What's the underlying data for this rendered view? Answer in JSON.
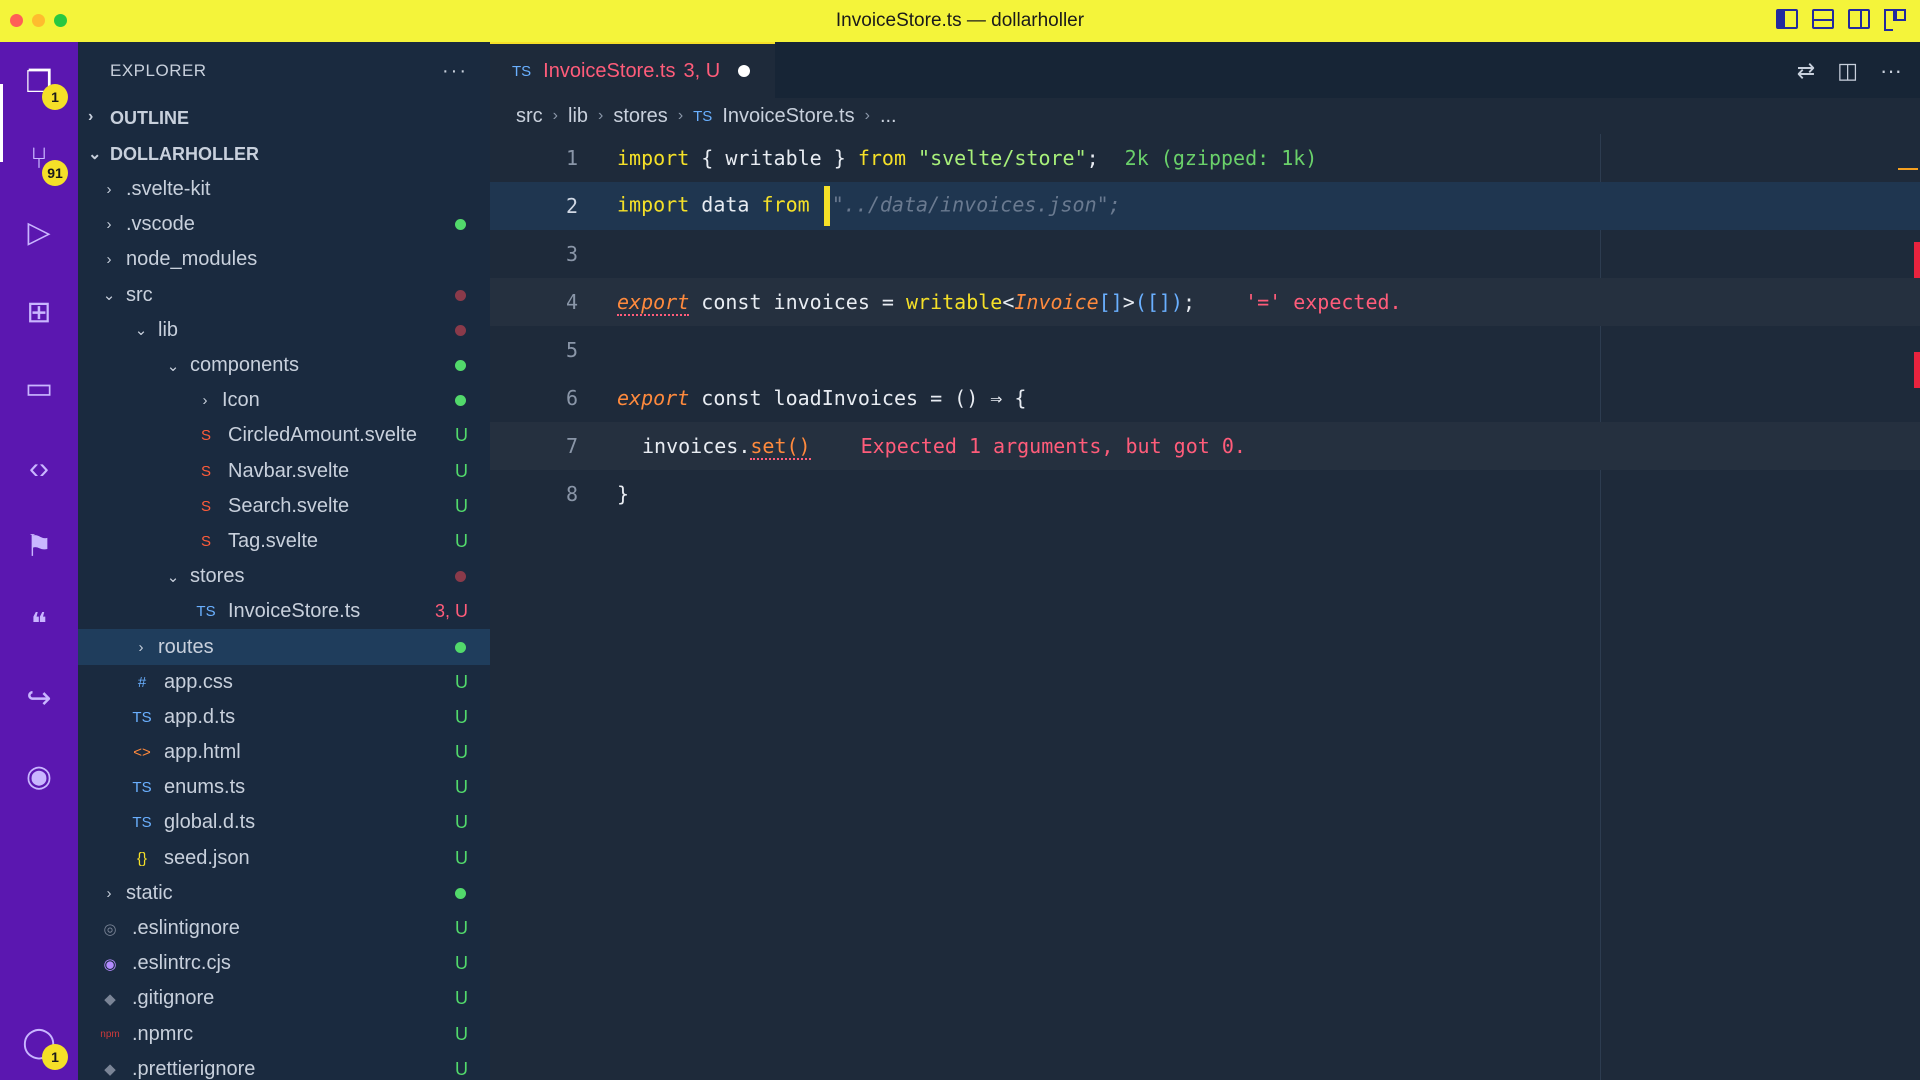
{
  "window": {
    "title": "InvoiceStore.ts — dollarholler"
  },
  "activity_bar": {
    "items": [
      {
        "name": "explorer-icon",
        "glyph": "❐",
        "badge": "1"
      },
      {
        "name": "source-control-icon",
        "glyph": "⑂",
        "badge": "91"
      },
      {
        "name": "run-debug-icon",
        "glyph": "▷",
        "badge": ""
      },
      {
        "name": "extensions-icon",
        "glyph": "⊞",
        "badge": ""
      },
      {
        "name": "folder-icon",
        "glyph": "▭",
        "badge": ""
      },
      {
        "name": "code-icon",
        "glyph": "‹›",
        "badge": ""
      },
      {
        "name": "bookmark-icon",
        "glyph": "⚑",
        "badge": ""
      },
      {
        "name": "quote-icon",
        "glyph": "❝",
        "badge": ""
      },
      {
        "name": "share-icon",
        "glyph": "↪",
        "badge": ""
      },
      {
        "name": "github-icon",
        "glyph": "◉",
        "badge": ""
      }
    ],
    "account_badge": "1"
  },
  "sidebar": {
    "header": "EXPLORER",
    "more": "···",
    "outline_label": "OUTLINE",
    "project_label": "DOLLARHOLLER",
    "tree": [
      {
        "name": ".svelte-kit",
        "depth": 0,
        "chev": "›",
        "icon": "",
        "color": "dim",
        "status": "",
        "dot": ""
      },
      {
        "name": ".vscode",
        "depth": 0,
        "chev": "›",
        "icon": "",
        "color": "green",
        "status": "",
        "dot": "#52d96b"
      },
      {
        "name": "node_modules",
        "depth": 0,
        "chev": "›",
        "icon": "",
        "color": "dim",
        "status": "",
        "dot": ""
      },
      {
        "name": "src",
        "depth": 0,
        "chev": "⌄",
        "icon": "",
        "color": "red",
        "status": "",
        "dot": "#8a3a4a"
      },
      {
        "name": "lib",
        "depth": 1,
        "chev": "⌄",
        "icon": "",
        "color": "red",
        "status": "",
        "dot": "#8a3a4a"
      },
      {
        "name": "components",
        "depth": 2,
        "chev": "⌄",
        "icon": "",
        "color": "green",
        "status": "",
        "dot": "#52d96b"
      },
      {
        "name": "Icon",
        "depth": 3,
        "chev": "›",
        "icon": "",
        "color": "green",
        "status": "",
        "dot": "#52d96b"
      },
      {
        "name": "CircledAmount.svelte",
        "depth": 3,
        "chev": "",
        "icon": "S",
        "color": "green",
        "status": "U",
        "dot": ""
      },
      {
        "name": "Navbar.svelte",
        "depth": 3,
        "chev": "",
        "icon": "S",
        "color": "green",
        "status": "U",
        "dot": ""
      },
      {
        "name": "Search.svelte",
        "depth": 3,
        "chev": "",
        "icon": "S",
        "color": "green",
        "status": "U",
        "dot": ""
      },
      {
        "name": "Tag.svelte",
        "depth": 3,
        "chev": "",
        "icon": "S",
        "color": "green",
        "status": "U",
        "dot": ""
      },
      {
        "name": "stores",
        "depth": 2,
        "chev": "⌄",
        "icon": "",
        "color": "red",
        "status": "",
        "dot": "#8a3a4a"
      },
      {
        "name": "InvoiceStore.ts",
        "depth": 3,
        "chev": "",
        "icon": "TS",
        "color": "red",
        "status": "3, U",
        "dot": ""
      },
      {
        "name": "routes",
        "depth": 1,
        "chev": "›",
        "icon": "",
        "color": "green",
        "status": "",
        "dot": "#52d96b",
        "selected": true
      },
      {
        "name": "app.css",
        "depth": 1,
        "chev": "",
        "icon": "#",
        "color": "green",
        "status": "U",
        "dot": ""
      },
      {
        "name": "app.d.ts",
        "depth": 1,
        "chev": "",
        "icon": "TS",
        "color": "green",
        "status": "U",
        "dot": ""
      },
      {
        "name": "app.html",
        "depth": 1,
        "chev": "",
        "icon": "<>",
        "color": "green",
        "status": "U",
        "dot": ""
      },
      {
        "name": "enums.ts",
        "depth": 1,
        "chev": "",
        "icon": "TS",
        "color": "green",
        "status": "U",
        "dot": ""
      },
      {
        "name": "global.d.ts",
        "depth": 1,
        "chev": "",
        "icon": "TS",
        "color": "green",
        "status": "U",
        "dot": ""
      },
      {
        "name": "seed.json",
        "depth": 1,
        "chev": "",
        "icon": "{}",
        "color": "green",
        "status": "U",
        "dot": ""
      },
      {
        "name": "static",
        "depth": 0,
        "chev": "›",
        "icon": "",
        "color": "green",
        "status": "",
        "dot": "#52d96b"
      },
      {
        "name": ".eslintignore",
        "depth": 0,
        "chev": "",
        "icon": "◎",
        "color": "green",
        "status": "U",
        "dot": ""
      },
      {
        "name": ".eslintrc.cjs",
        "depth": 0,
        "chev": "",
        "icon": "◉",
        "color": "green",
        "status": "U",
        "dot": ""
      },
      {
        "name": ".gitignore",
        "depth": 0,
        "chev": "",
        "icon": "◆",
        "color": "green",
        "status": "U",
        "dot": ""
      },
      {
        "name": ".npmrc",
        "depth": 0,
        "chev": "",
        "icon": "npm",
        "color": "green",
        "status": "U",
        "dot": ""
      },
      {
        "name": ".prettierignore",
        "depth": 0,
        "chev": "",
        "icon": "◆",
        "color": "green",
        "status": "U",
        "dot": ""
      }
    ]
  },
  "editor": {
    "tab": {
      "lang": "TS",
      "name": "InvoiceStore.ts",
      "status": "3, U"
    },
    "breadcrumb": {
      "parts": [
        "src",
        "lib",
        "stores"
      ],
      "file_lang": "TS",
      "file": "InvoiceStore.ts",
      "tail": "..."
    },
    "lines": {
      "l1": {
        "num": "1",
        "kw1": "import",
        "p1": " { writable } ",
        "kw2": "from",
        "p2": " ",
        "str": "\"svelte/store\"",
        "p3": ";",
        "hint": "2k (gzipped: 1k)"
      },
      "l2": {
        "num": "2",
        "kw1": "import",
        "p1": " data ",
        "kw2": "from",
        "p2": " ",
        "str": "\"../data/invoices.json\";"
      },
      "l3": {
        "num": "3"
      },
      "l4": {
        "num": "4",
        "kw1": "export",
        "p1": " const invoices = ",
        "fn": "writable",
        "lt": "<",
        "typ": "Invoice",
        "arr": "[]",
        "gt": ">",
        "args": "([])",
        "p2": ";",
        "err": "'=' expected."
      },
      "l5": {
        "num": "5"
      },
      "l6": {
        "num": "6",
        "kw1": "export",
        "p1": " const loadInvoices = () ⇒ {"
      },
      "l7": {
        "num": "7",
        "obj": "invoices",
        "dot": ".",
        "meth": "set()",
        "err": "Expected 1 arguments, but got 0."
      },
      "l8": {
        "num": "8",
        "brace": "}"
      }
    }
  }
}
